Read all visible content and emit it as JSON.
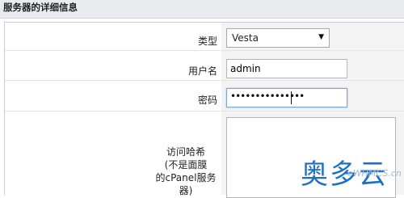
{
  "section": {
    "title": "服务器的详细信息"
  },
  "form": {
    "type_label": "类型",
    "type_value": "Vesta",
    "username_label": "用户名",
    "username_value": "admin",
    "password_label": "密码",
    "password_mask": "•••••••••••••••",
    "accesshash_label_line1": "访问哈希",
    "accesshash_label_line2": "(不是面膜",
    "accesshash_label_line3": "的cPanel服务器)"
  },
  "watermark": {
    "text": "奥多云",
    "subtext": "eWHMCS.cn"
  },
  "colors": {
    "focus_border": "#7aa5d6",
    "watermark": "#1e6fc4"
  }
}
